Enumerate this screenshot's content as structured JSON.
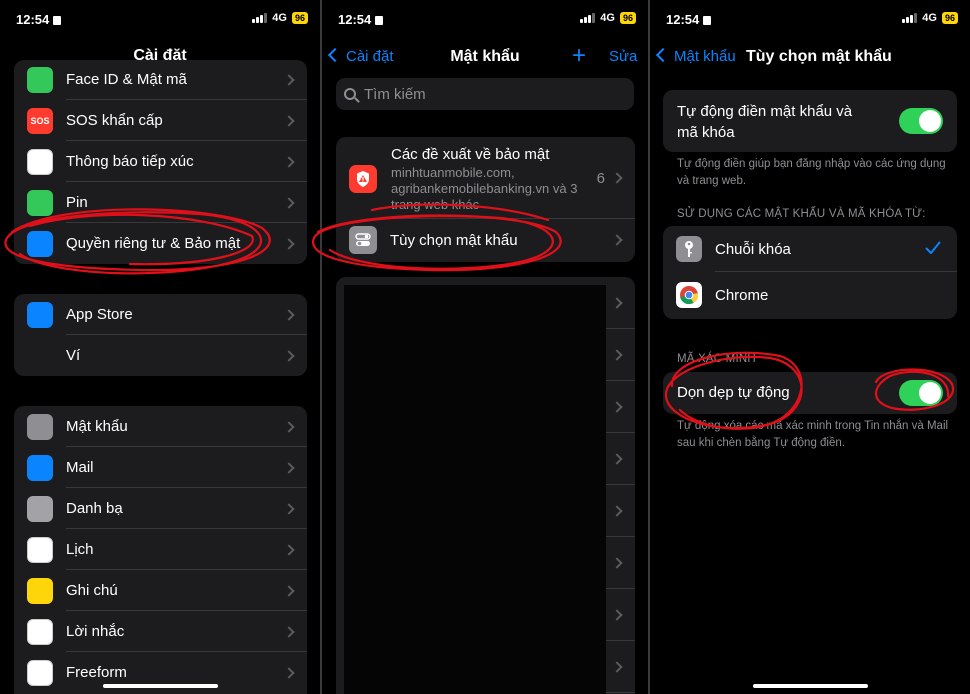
{
  "status": {
    "time": "12:54",
    "network": "4G",
    "battery": "96"
  },
  "panel1": {
    "title": "Cài đặt",
    "group1": [
      {
        "label": "Face ID & Mật mã",
        "icon": "faceid-icon",
        "color": "#34c759"
      },
      {
        "label": "SOS khẩn cấp",
        "icon": "sos-icon",
        "icon_text": "SOS",
        "color": "#ff3b30"
      },
      {
        "label": "Thông báo tiếp xúc",
        "icon": "exposure-icon",
        "color": "#ffffff"
      },
      {
        "label": "Pin",
        "icon": "battery-icon",
        "color": "#34c759"
      },
      {
        "label": "Quyền riêng tư & Bảo mật",
        "icon": "hand-icon",
        "color": "#0a84ff"
      }
    ],
    "group2": [
      {
        "label": "App Store",
        "icon": "appstore-icon",
        "color": "#0a84ff"
      },
      {
        "label": "Ví",
        "icon": "wallet-icon",
        "color": "#1c1c1e"
      }
    ],
    "group3": [
      {
        "label": "Mật khẩu",
        "icon": "key-icon",
        "color": "#8e8e93"
      },
      {
        "label": "Mail",
        "icon": "mail-icon",
        "color": "#0a84ff"
      },
      {
        "label": "Danh bạ",
        "icon": "contacts-icon",
        "color": "#a2a2a7"
      },
      {
        "label": "Lịch",
        "icon": "calendar-icon",
        "color": "#ffffff"
      },
      {
        "label": "Ghi chú",
        "icon": "notes-icon",
        "color": "#ffd60a"
      },
      {
        "label": "Lời nhắc",
        "icon": "reminders-icon",
        "color": "#ffffff"
      },
      {
        "label": "Freeform",
        "icon": "freeform-icon",
        "color": "#ffffff"
      }
    ]
  },
  "panel2": {
    "back": "Cài đặt",
    "title": "Mật khẩu",
    "add": "+",
    "edit": "Sửa",
    "search_placeholder": "Tìm kiếm",
    "security_title": "Các đề xuất về bảo mật",
    "security_sub": "minhtuanmobile.com, agribankemobilebanking.vn và 3 trang web khác",
    "security_count": "6",
    "options_label": "Tùy chọn mật khẩu"
  },
  "panel3": {
    "back": "Mật khẩu",
    "title": "Tùy chọn mật khẩu",
    "autofill_label": "Tự động điền mật khẩu và mã khóa",
    "autofill_on": true,
    "autofill_footer": "Tự động điền giúp bạn đăng nhập vào các ứng dụng và trang web.",
    "use_from_header": "SỬ DỤNG CÁC MẬT KHẨU VÀ MÃ KHÓA TỪ:",
    "sources": [
      {
        "label": "Chuỗi khóa",
        "icon": "keychain-icon",
        "checked": true
      },
      {
        "label": "Chrome",
        "icon": "chrome-icon",
        "checked": false
      }
    ],
    "code_header": "MÃ XÁC MINH",
    "cleanup_label": "Dọn dẹp tự động",
    "cleanup_on": true,
    "cleanup_footer": "Tự động xóa các mã xác minh trong Tin nhắn và Mail sau khi chèn bằng Tự động điền."
  },
  "colors": {
    "accent": "#0a84ff",
    "toggle_on": "#30d158",
    "annotation": "#e0101a"
  }
}
